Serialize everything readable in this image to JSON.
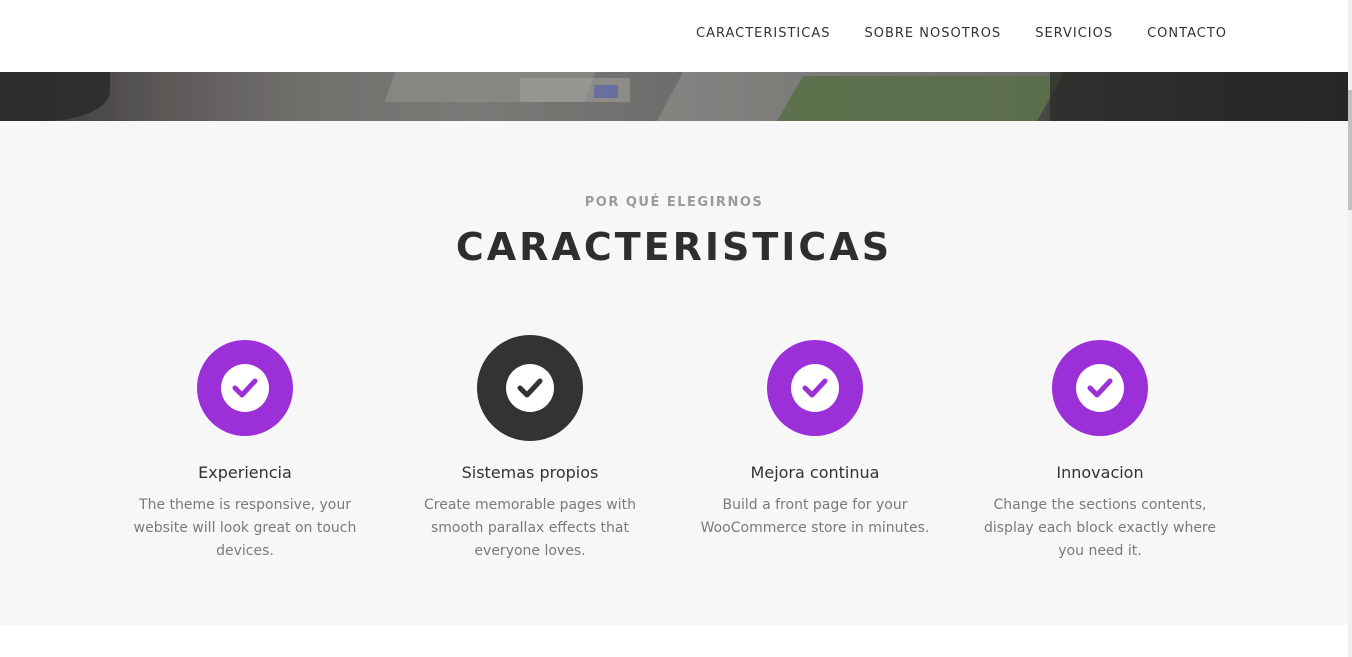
{
  "nav": {
    "items": [
      {
        "label": "CARACTERISTICAS"
      },
      {
        "label": "SOBRE NOSOTROS"
      },
      {
        "label": "SERVICIOS"
      },
      {
        "label": "CONTACTO"
      }
    ]
  },
  "features": {
    "kicker": "POR QUÉ ELEGIRNOS",
    "title": "CARACTERISTICAS",
    "items": [
      {
        "title": "Experiencia",
        "text": "The theme is responsive, your website will look great on touch devices.",
        "icon": "check-circle-icon",
        "color": "#9b30d9"
      },
      {
        "title": "Sistemas propios",
        "text": "Create memorable pages with smooth parallax effects that everyone loves.",
        "icon": "check-circle-icon",
        "color": "#333333"
      },
      {
        "title": "Mejora continua",
        "text": "Build a front page for your WooCommerce store in minutes.",
        "icon": "check-circle-icon",
        "color": "#9b30d9"
      },
      {
        "title": "Innovacion",
        "text": "Change the sections contents, display each block exactly where you need it.",
        "icon": "check-circle-icon",
        "color": "#9b30d9"
      }
    ]
  },
  "colors": {
    "accent": "#9b30d9",
    "dark": "#333333",
    "section_bg": "#f6f7f6"
  }
}
